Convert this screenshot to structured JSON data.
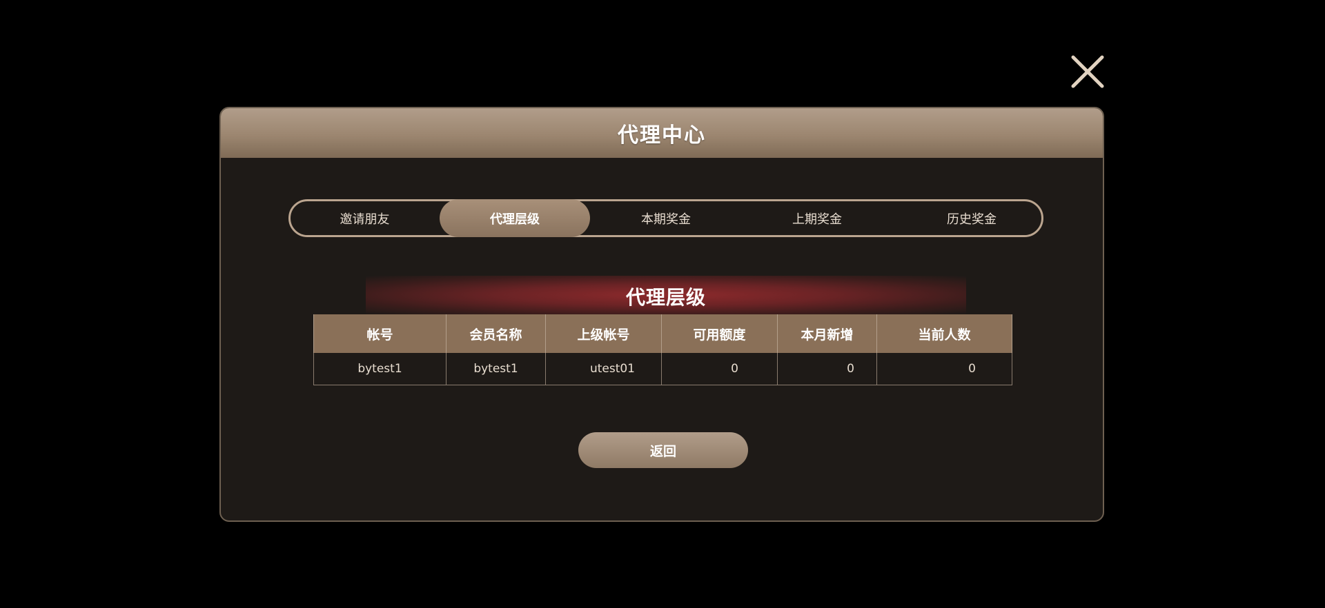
{
  "close_button": {
    "icon": "close-icon",
    "color": "#e2d3c1"
  },
  "dialog": {
    "title": "代理中心"
  },
  "tabs": [
    {
      "label": "邀请朋友",
      "active": false
    },
    {
      "label": "代理层级",
      "active": true
    },
    {
      "label": "本期奖金",
      "active": false
    },
    {
      "label": "上期奖金",
      "active": false
    },
    {
      "label": "历史奖金",
      "active": false
    }
  ],
  "section": {
    "title": "代理层级"
  },
  "table": {
    "headers": [
      "帐号",
      "会员名称",
      "上级帐号",
      "可用额度",
      "本月新增",
      "当前人数"
    ],
    "rows": [
      [
        "bytest1",
        "bytest1",
        "utest01",
        "0",
        "0",
        "0"
      ]
    ]
  },
  "back_button": {
    "label": "返回"
  },
  "colors": {
    "background": "#000000",
    "panel": "#1e1a17",
    "accent": "#a89079",
    "banner_red": "#8e2a2c"
  }
}
